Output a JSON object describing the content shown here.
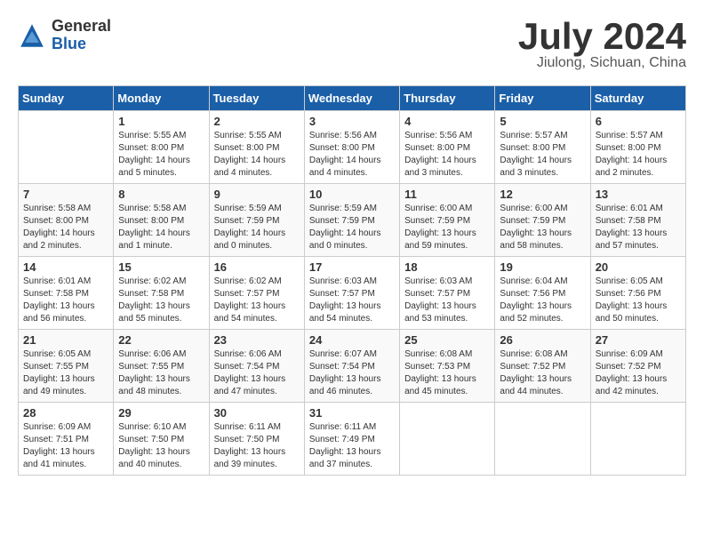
{
  "header": {
    "logo_general": "General",
    "logo_blue": "Blue",
    "title": "July 2024",
    "location": "Jiulong, Sichuan, China"
  },
  "days_of_week": [
    "Sunday",
    "Monday",
    "Tuesday",
    "Wednesday",
    "Thursday",
    "Friday",
    "Saturday"
  ],
  "weeks": [
    [
      {
        "day": "",
        "info": ""
      },
      {
        "day": "1",
        "info": "Sunrise: 5:55 AM\nSunset: 8:00 PM\nDaylight: 14 hours\nand 5 minutes."
      },
      {
        "day": "2",
        "info": "Sunrise: 5:55 AM\nSunset: 8:00 PM\nDaylight: 14 hours\nand 4 minutes."
      },
      {
        "day": "3",
        "info": "Sunrise: 5:56 AM\nSunset: 8:00 PM\nDaylight: 14 hours\nand 4 minutes."
      },
      {
        "day": "4",
        "info": "Sunrise: 5:56 AM\nSunset: 8:00 PM\nDaylight: 14 hours\nand 3 minutes."
      },
      {
        "day": "5",
        "info": "Sunrise: 5:57 AM\nSunset: 8:00 PM\nDaylight: 14 hours\nand 3 minutes."
      },
      {
        "day": "6",
        "info": "Sunrise: 5:57 AM\nSunset: 8:00 PM\nDaylight: 14 hours\nand 2 minutes."
      }
    ],
    [
      {
        "day": "7",
        "info": "Sunrise: 5:58 AM\nSunset: 8:00 PM\nDaylight: 14 hours\nand 2 minutes."
      },
      {
        "day": "8",
        "info": "Sunrise: 5:58 AM\nSunset: 8:00 PM\nDaylight: 14 hours\nand 1 minute."
      },
      {
        "day": "9",
        "info": "Sunrise: 5:59 AM\nSunset: 7:59 PM\nDaylight: 14 hours\nand 0 minutes."
      },
      {
        "day": "10",
        "info": "Sunrise: 5:59 AM\nSunset: 7:59 PM\nDaylight: 14 hours\nand 0 minutes."
      },
      {
        "day": "11",
        "info": "Sunrise: 6:00 AM\nSunset: 7:59 PM\nDaylight: 13 hours\nand 59 minutes."
      },
      {
        "day": "12",
        "info": "Sunrise: 6:00 AM\nSunset: 7:59 PM\nDaylight: 13 hours\nand 58 minutes."
      },
      {
        "day": "13",
        "info": "Sunrise: 6:01 AM\nSunset: 7:58 PM\nDaylight: 13 hours\nand 57 minutes."
      }
    ],
    [
      {
        "day": "14",
        "info": "Sunrise: 6:01 AM\nSunset: 7:58 PM\nDaylight: 13 hours\nand 56 minutes."
      },
      {
        "day": "15",
        "info": "Sunrise: 6:02 AM\nSunset: 7:58 PM\nDaylight: 13 hours\nand 55 minutes."
      },
      {
        "day": "16",
        "info": "Sunrise: 6:02 AM\nSunset: 7:57 PM\nDaylight: 13 hours\nand 54 minutes."
      },
      {
        "day": "17",
        "info": "Sunrise: 6:03 AM\nSunset: 7:57 PM\nDaylight: 13 hours\nand 54 minutes."
      },
      {
        "day": "18",
        "info": "Sunrise: 6:03 AM\nSunset: 7:57 PM\nDaylight: 13 hours\nand 53 minutes."
      },
      {
        "day": "19",
        "info": "Sunrise: 6:04 AM\nSunset: 7:56 PM\nDaylight: 13 hours\nand 52 minutes."
      },
      {
        "day": "20",
        "info": "Sunrise: 6:05 AM\nSunset: 7:56 PM\nDaylight: 13 hours\nand 50 minutes."
      }
    ],
    [
      {
        "day": "21",
        "info": "Sunrise: 6:05 AM\nSunset: 7:55 PM\nDaylight: 13 hours\nand 49 minutes."
      },
      {
        "day": "22",
        "info": "Sunrise: 6:06 AM\nSunset: 7:55 PM\nDaylight: 13 hours\nand 48 minutes."
      },
      {
        "day": "23",
        "info": "Sunrise: 6:06 AM\nSunset: 7:54 PM\nDaylight: 13 hours\nand 47 minutes."
      },
      {
        "day": "24",
        "info": "Sunrise: 6:07 AM\nSunset: 7:54 PM\nDaylight: 13 hours\nand 46 minutes."
      },
      {
        "day": "25",
        "info": "Sunrise: 6:08 AM\nSunset: 7:53 PM\nDaylight: 13 hours\nand 45 minutes."
      },
      {
        "day": "26",
        "info": "Sunrise: 6:08 AM\nSunset: 7:52 PM\nDaylight: 13 hours\nand 44 minutes."
      },
      {
        "day": "27",
        "info": "Sunrise: 6:09 AM\nSunset: 7:52 PM\nDaylight: 13 hours\nand 42 minutes."
      }
    ],
    [
      {
        "day": "28",
        "info": "Sunrise: 6:09 AM\nSunset: 7:51 PM\nDaylight: 13 hours\nand 41 minutes."
      },
      {
        "day": "29",
        "info": "Sunrise: 6:10 AM\nSunset: 7:50 PM\nDaylight: 13 hours\nand 40 minutes."
      },
      {
        "day": "30",
        "info": "Sunrise: 6:11 AM\nSunset: 7:50 PM\nDaylight: 13 hours\nand 39 minutes."
      },
      {
        "day": "31",
        "info": "Sunrise: 6:11 AM\nSunset: 7:49 PM\nDaylight: 13 hours\nand 37 minutes."
      },
      {
        "day": "",
        "info": ""
      },
      {
        "day": "",
        "info": ""
      },
      {
        "day": "",
        "info": ""
      }
    ]
  ]
}
